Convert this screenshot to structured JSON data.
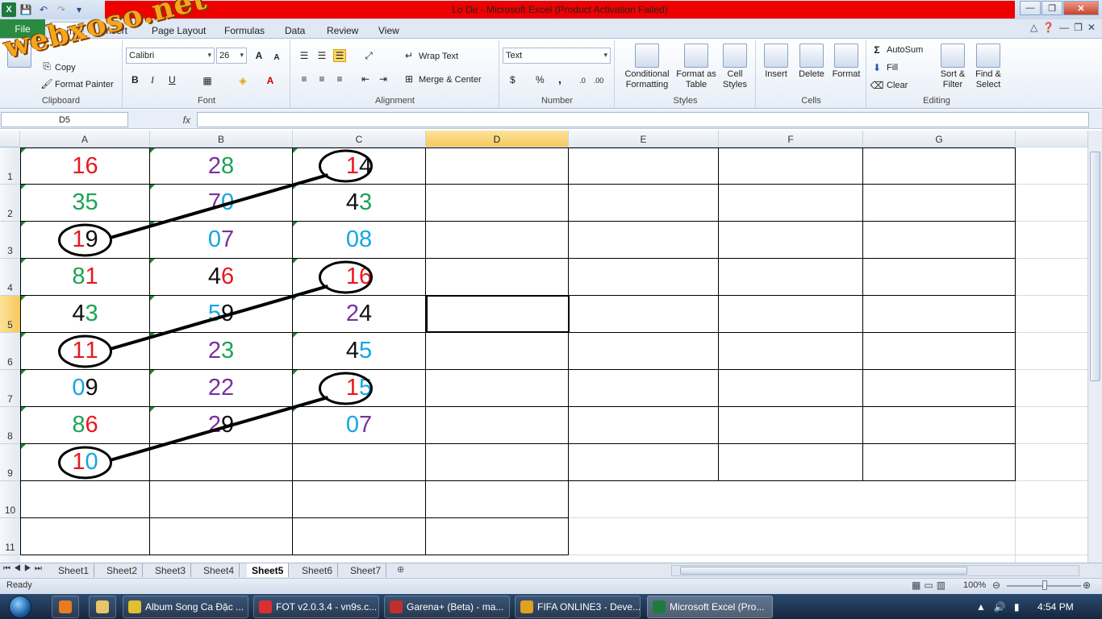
{
  "window": {
    "title": "Lo De  -  Microsoft Excel (Product Activation Failed)"
  },
  "watermark": "webxoso.net",
  "tabs": [
    {
      "label": "File",
      "active": false
    },
    {
      "label": "Home",
      "active": true
    },
    {
      "label": "Insert",
      "active": false
    },
    {
      "label": "Page Layout",
      "active": false
    },
    {
      "label": "Formulas",
      "active": false
    },
    {
      "label": "Data",
      "active": false
    },
    {
      "label": "Review",
      "active": false
    },
    {
      "label": "View",
      "active": false
    }
  ],
  "ribbon": {
    "clipboard": {
      "copy": "Copy",
      "format_painter": "Format Painter",
      "label": "Clipboard"
    },
    "font": {
      "name": "Calibri",
      "size": "26",
      "bold": "B",
      "italic": "I",
      "underline": "U",
      "label": "Font"
    },
    "alignment": {
      "wrap_text": "Wrap Text",
      "merge_center": "Merge & Center",
      "label": "Alignment"
    },
    "number": {
      "format": "Text",
      "currency": "$",
      "percent": "%",
      "comma": ",",
      "label": "Number"
    },
    "styles": {
      "conditional": "Conditional Formatting",
      "format_table": "Format as Table",
      "cell_styles": "Cell Styles",
      "label": "Styles"
    },
    "cells": {
      "insert": "Insert",
      "delete": "Delete",
      "format": "Format",
      "label": "Cells"
    },
    "editing": {
      "autosum": "AutoSum",
      "fill": "Fill",
      "clear": "Clear",
      "sort_filter": "Sort & Filter",
      "find_select": "Find & Select",
      "label": "Editing"
    }
  },
  "formula_bar": {
    "name_box": "D5",
    "fx": "fx",
    "value": ""
  },
  "columns": [
    "A",
    "B",
    "C",
    "D",
    "E",
    "F",
    "G"
  ],
  "selected_column": "D",
  "rows": [
    "1",
    "2",
    "3",
    "4",
    "5",
    "6",
    "7",
    "8",
    "9",
    "10",
    "11"
  ],
  "selected_row": "5",
  "cells": {
    "A": [
      [
        {
          "t": "1",
          "c": "#e8181e"
        },
        {
          "t": "6",
          "c": "#e8181e"
        }
      ],
      [
        {
          "t": "3",
          "c": "#1aa553"
        },
        {
          "t": "5",
          "c": "#1aa553"
        }
      ],
      [
        {
          "t": "1",
          "c": "#e8181e"
        },
        {
          "t": "9",
          "c": "#111111"
        }
      ],
      [
        {
          "t": "8",
          "c": "#1aa553"
        },
        {
          "t": "1",
          "c": "#e8181e"
        }
      ],
      [
        {
          "t": "4",
          "c": "#111111"
        },
        {
          "t": "3",
          "c": "#1aa553"
        }
      ],
      [
        {
          "t": "1",
          "c": "#e8181e"
        },
        {
          "t": "1",
          "c": "#e8181e"
        }
      ],
      [
        {
          "t": "0",
          "c": "#13a6e0"
        },
        {
          "t": "9",
          "c": "#111111"
        }
      ],
      [
        {
          "t": "8",
          "c": "#1aa553"
        },
        {
          "t": "6",
          "c": "#e8181e"
        }
      ],
      [
        {
          "t": "1",
          "c": "#e8181e"
        },
        {
          "t": "0",
          "c": "#13a6e0"
        }
      ]
    ],
    "B": [
      [
        {
          "t": "2",
          "c": "#7a2fa0"
        },
        {
          "t": "8",
          "c": "#1aa553"
        }
      ],
      [
        {
          "t": "7",
          "c": "#7a2fa0"
        },
        {
          "t": "0",
          "c": "#13a6e0"
        }
      ],
      [
        {
          "t": "0",
          "c": "#13a6e0"
        },
        {
          "t": "7",
          "c": "#7a2fa0"
        }
      ],
      [
        {
          "t": "4",
          "c": "#111111"
        },
        {
          "t": "6",
          "c": "#e8181e"
        }
      ],
      [
        {
          "t": "5",
          "c": "#13a6e0"
        },
        {
          "t": "9",
          "c": "#111111"
        }
      ],
      [
        {
          "t": "2",
          "c": "#7a2fa0"
        },
        {
          "t": "3",
          "c": "#1aa553"
        }
      ],
      [
        {
          "t": "2",
          "c": "#7a2fa0"
        },
        {
          "t": "2",
          "c": "#7a2fa0"
        }
      ],
      [
        {
          "t": "2",
          "c": "#7a2fa0"
        },
        {
          "t": "9",
          "c": "#111111"
        }
      ]
    ],
    "C": [
      [
        {
          "t": "1",
          "c": "#e8181e"
        },
        {
          "t": "4",
          "c": "#111111"
        }
      ],
      [
        {
          "t": "4",
          "c": "#111111"
        },
        {
          "t": "3",
          "c": "#1aa553"
        }
      ],
      [
        {
          "t": "0",
          "c": "#13a6e0"
        },
        {
          "t": "8",
          "c": "#13a6e0"
        }
      ],
      [
        {
          "t": "1",
          "c": "#e8181e"
        },
        {
          "t": "6",
          "c": "#e8181e"
        }
      ],
      [
        {
          "t": "2",
          "c": "#7a2fa0"
        },
        {
          "t": "4",
          "c": "#111111"
        }
      ],
      [
        {
          "t": "4",
          "c": "#111111"
        },
        {
          "t": "5",
          "c": "#13a6e0"
        }
      ],
      [
        {
          "t": "1",
          "c": "#e8181e"
        },
        {
          "t": "5",
          "c": "#13a6e0"
        }
      ],
      [
        {
          "t": "0",
          "c": "#13a6e0"
        },
        {
          "t": "7",
          "c": "#7a2fa0"
        }
      ]
    ]
  },
  "annotations": [
    {
      "from": {
        "col": "A",
        "row": 3
      },
      "to": {
        "col": "C",
        "row": 1
      }
    },
    {
      "from": {
        "col": "A",
        "row": 6
      },
      "to": {
        "col": "C",
        "row": 4
      }
    },
    {
      "from": {
        "col": "A",
        "row": 9
      },
      "to": {
        "col": "C",
        "row": 7
      }
    }
  ],
  "sheets": [
    "Sheet1",
    "Sheet2",
    "Sheet3",
    "Sheet4",
    "Sheet5",
    "Sheet6",
    "Sheet7"
  ],
  "active_sheet": "Sheet5",
  "status": {
    "ready": "Ready",
    "zoom": "100%"
  },
  "taskbar": {
    "items": [
      {
        "label": "Album Song Ca Đặc ...",
        "icon_color": "#e0c030"
      },
      {
        "label": "FOT v2.0.3.4 - vn9s.c...",
        "icon_color": "#d83030"
      },
      {
        "label": "Garena+ (Beta) - ma...",
        "icon_color": "#c0302a"
      },
      {
        "label": "FIFA ONLINE3 - Deve...",
        "icon_color": "#e0a020"
      },
      {
        "label": "Microsoft Excel (Pro...",
        "icon_color": "#1e7a3c",
        "active": true
      }
    ],
    "clock": "4:54 PM"
  }
}
